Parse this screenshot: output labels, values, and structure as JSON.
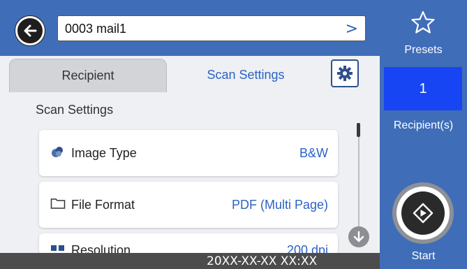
{
  "header": {
    "subject_value": "0003 mail1",
    "subject_chevron": ">"
  },
  "tabs": [
    {
      "label": "Recipient",
      "active": false
    },
    {
      "label": "Scan Settings",
      "active": true
    }
  ],
  "section_title": "Scan Settings",
  "settings": [
    {
      "label": "Image Type",
      "value": "B&W",
      "icon": "color-drop-icon"
    },
    {
      "label": "File Format",
      "value": "PDF (Multi Page)",
      "icon": "folder-icon"
    },
    {
      "label": "Resolution",
      "value": "200 dpi",
      "icon": "grid-icon"
    }
  ],
  "status_bar": {
    "datetime": "20XX-XX-XX XX:XX"
  },
  "sidebar": {
    "presets_label": "Presets",
    "recipient_count": "1",
    "recipient_label": "Recipient(s)",
    "start_label": "Start"
  },
  "colors": {
    "accent_blue": "#3f6db8",
    "highlight_blue": "#1745f4",
    "link_blue": "#2b63c6",
    "status_bar": "#4c4c4c"
  }
}
